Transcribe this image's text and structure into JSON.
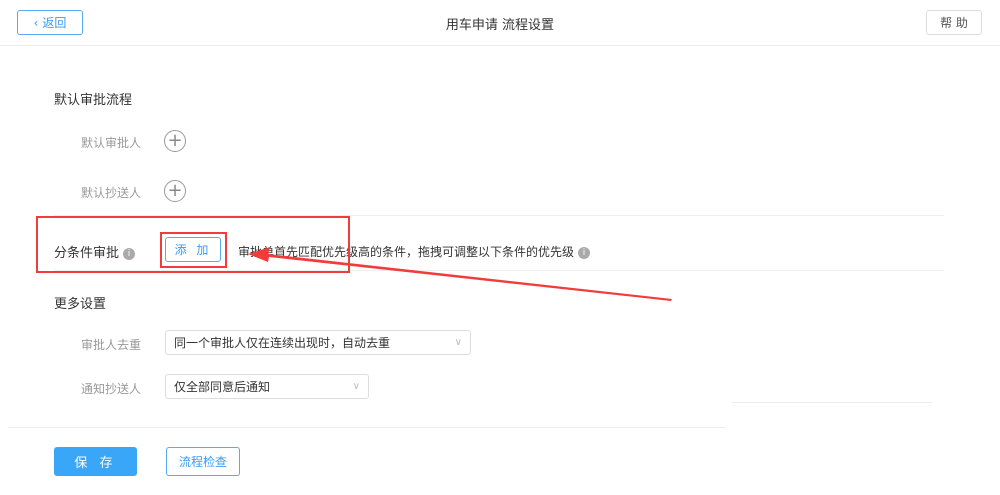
{
  "header": {
    "back_label": "返回",
    "title": "用车申请 流程设置",
    "help_label": "帮 助"
  },
  "default_flow": {
    "title": "默认审批流程",
    "approver_label": "默认审批人",
    "cc_label": "默认抄送人"
  },
  "conditional": {
    "title": "分条件审批",
    "add_label": "添 加",
    "hint": "审批单首先匹配优先级高的条件，拖拽可调整以下条件的优先级"
  },
  "more": {
    "title": "更多设置",
    "dedupe_label": "审批人去重",
    "dedupe_value": "同一个审批人仅在连续出现时，自动去重",
    "notify_label": "通知抄送人",
    "notify_value": "仅全部同意后通知"
  },
  "footer": {
    "save_label": "保 存",
    "check_label": "流程检查"
  },
  "annotation_color": "#f23b3b"
}
